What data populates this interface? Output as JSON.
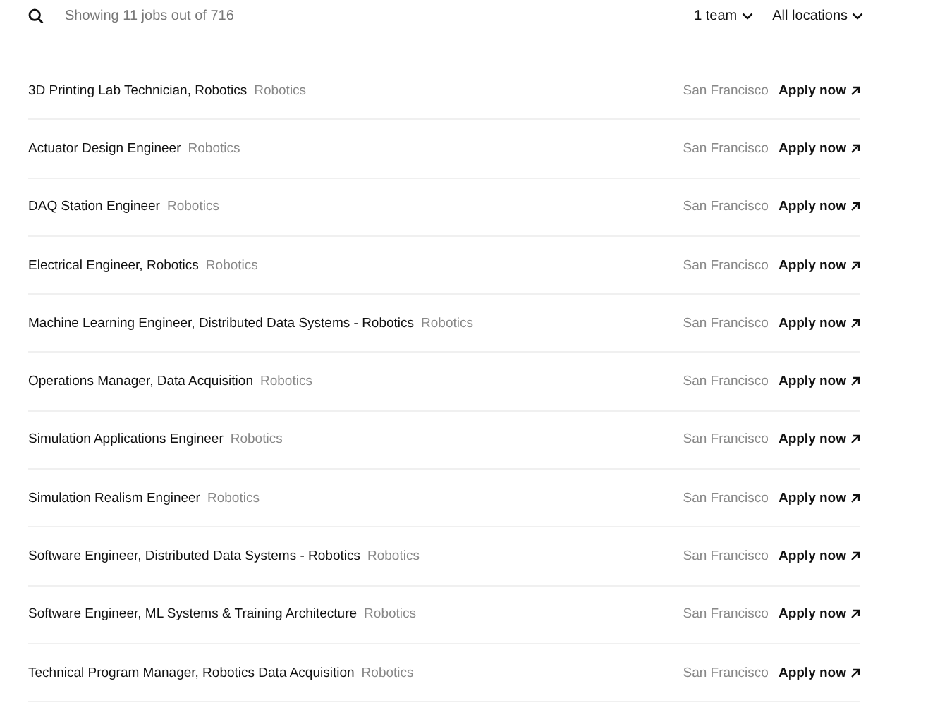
{
  "results_summary": "Showing 11 jobs out of 716",
  "filters": [
    {
      "label": "1 team"
    },
    {
      "label": "All locations"
    }
  ],
  "jobs": [
    {
      "title": "3D Printing Lab Technician, Robotics",
      "team": "Robotics",
      "location": "San Francisco",
      "action": "Apply now"
    },
    {
      "title": "Actuator Design Engineer",
      "team": "Robotics",
      "location": "San Francisco",
      "action": "Apply now"
    },
    {
      "title": "DAQ Station Engineer",
      "team": "Robotics",
      "location": "San Francisco",
      "action": "Apply now"
    },
    {
      "title": "Electrical Engineer, Robotics",
      "team": "Robotics",
      "location": "San Francisco",
      "action": "Apply now"
    },
    {
      "title": "Machine Learning Engineer, Distributed Data Systems - Robotics",
      "team": "Robotics",
      "location": "San Francisco",
      "action": "Apply now"
    },
    {
      "title": "Operations Manager, Data Acquisition",
      "team": "Robotics",
      "location": "San Francisco",
      "action": "Apply now"
    },
    {
      "title": "Simulation Applications Engineer",
      "team": "Robotics",
      "location": "San Francisco",
      "action": "Apply now"
    },
    {
      "title": "Simulation Realism Engineer",
      "team": "Robotics",
      "location": "San Francisco",
      "action": "Apply now"
    },
    {
      "title": "Software Engineer, Distributed Data Systems - Robotics",
      "team": "Robotics",
      "location": "San Francisco",
      "action": "Apply now"
    },
    {
      "title": "Software Engineer, ML Systems & Training Architecture",
      "team": "Robotics",
      "location": "San Francisco",
      "action": "Apply now"
    },
    {
      "title": "Technical Program Manager, Robotics Data Acquisition",
      "team": "Robotics",
      "location": "San Francisco",
      "action": "Apply now"
    }
  ]
}
